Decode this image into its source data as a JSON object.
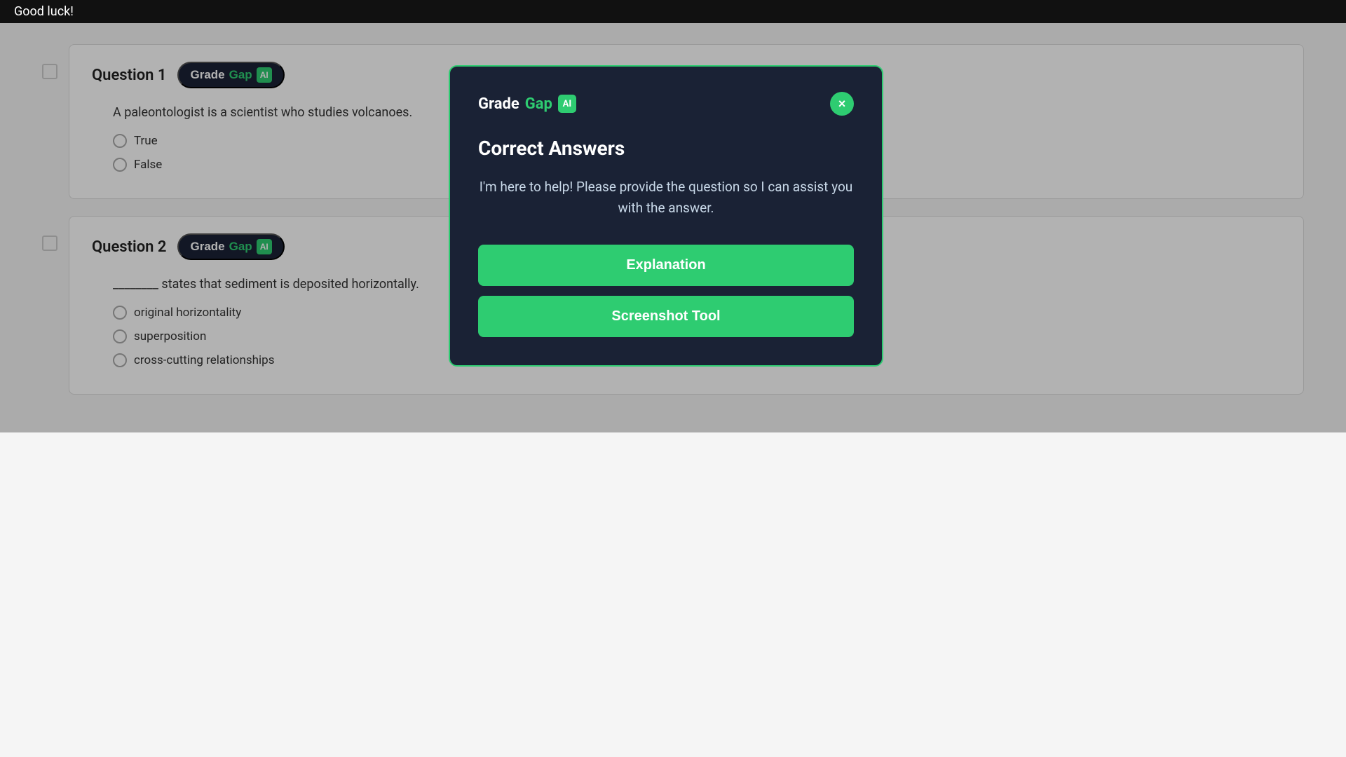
{
  "topbar": {
    "text": "Good luck!"
  },
  "questions": [
    {
      "id": "q1",
      "number": "Question 1",
      "badge": {
        "grade": "Grade",
        "gap": "Gap",
        "icon": "AI"
      },
      "text": "A paleontologist is a scientist who studies volcanoes.",
      "options": [
        {
          "label": "True"
        },
        {
          "label": "False"
        }
      ]
    },
    {
      "id": "q2",
      "number": "Question 2",
      "badge": {
        "grade": "Grade",
        "gap": "Gap",
        "icon": "AI"
      },
      "text": "________ states that sediment is deposited horizontally.",
      "options": [
        {
          "label": "original horizontality"
        },
        {
          "label": "superposition"
        },
        {
          "label": "cross-cutting relationships"
        }
      ]
    }
  ],
  "modal": {
    "logo_grade": "Grade",
    "logo_gap": "Gap",
    "logo_icon": "AI",
    "close_label": "×",
    "title": "Correct Answers",
    "body_text": "I'm here to help! Please provide the question so I can assist you with the answer.",
    "explanation_btn": "Explanation",
    "screenshot_btn": "Screenshot Tool"
  },
  "colors": {
    "green": "#2ecc71",
    "dark_bg": "#1a2235",
    "white": "#ffffff"
  }
}
